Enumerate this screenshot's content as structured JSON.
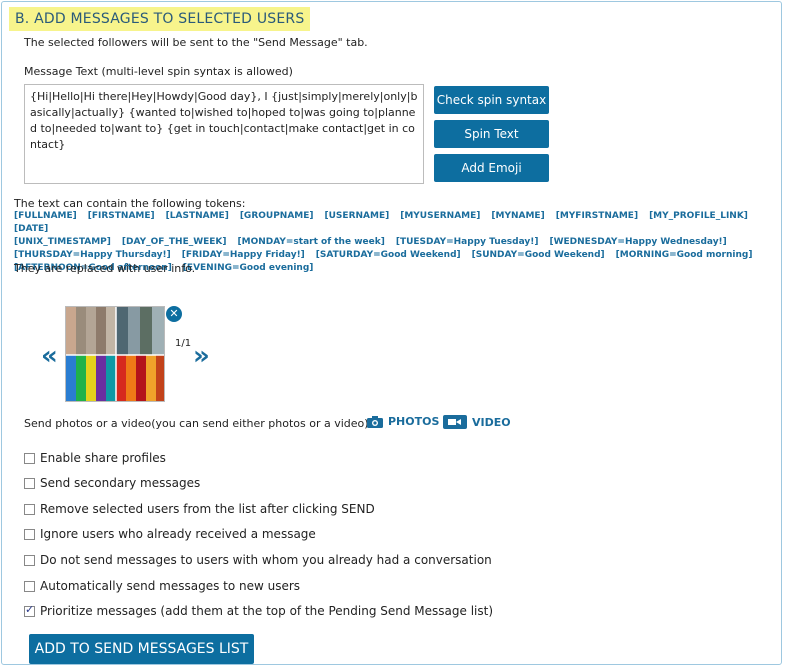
{
  "section": {
    "title": "B. ADD MESSAGES TO SELECTED USERS",
    "note": "The selected followers will be sent to the \"Send Message\" tab."
  },
  "message": {
    "label": "Message Text  (multi-level spin syntax is allowed)",
    "text": "{Hi|Hello|Hi there|Hey|Howdy|Good day}, I {just|simply|merely|only|basically|actually} {wanted to|wished to|hoped to|was going to|planned to|needed to|want to} {get in touch|contact|make contact|get in contact}"
  },
  "buttons": {
    "check_spin": "Check spin syntax",
    "spin_text": "Spin Text",
    "add_emoji": "Add Emoji",
    "add_to_list": "ADD TO SEND MESSAGES LIST"
  },
  "tokens": {
    "intro": "The text can contain the following tokens:",
    "items": [
      "[FULLNAME]",
      "[FIRSTNAME]",
      "[LASTNAME]",
      "[GROUPNAME]",
      "[USERNAME]",
      "[MYUSERNAME]",
      "[MYNAME]",
      "[MYFIRSTNAME]",
      "[MY_PROFILE_LINK]",
      "[DATE]",
      "[UNIX_TIMESTAMP]",
      "[DAY_OF_THE_WEEK]",
      "[MONDAY=start of the week]",
      "[TUESDAY=Happy Tuesday!]",
      "[WEDNESDAY=Happy Wednesday!]",
      "[THURSDAY=Happy Thursday!]",
      "[FRIDAY=Happy Friday!]",
      "[SATURDAY=Good Weekend]",
      "[SUNDAY=Good Weekend]",
      "[MORNING=Good morning]",
      "[AFTERNOON=Good afternoon]",
      "[EVENING=Good evening]"
    ],
    "outro": "They are replaced with user info."
  },
  "media": {
    "counter": "1/1",
    "label": "Send photos or a video(you can send either photos or a video)",
    "photos": "PHOTOS",
    "video": "VIDEO",
    "prev_icon": "double-chevron-left-icon",
    "next_icon": "double-chevron-right-icon",
    "remove_icon": "close-icon"
  },
  "options": [
    {
      "label": "Enable share profiles",
      "checked": false
    },
    {
      "label": "Send secondary messages",
      "checked": false
    },
    {
      "label": "Remove selected users from the list after clicking SEND",
      "checked": false
    },
    {
      "label": "Ignore users who already received a message",
      "checked": false
    },
    {
      "label": "Do not send messages to users with whom you already had a conversation",
      "checked": false
    },
    {
      "label": "Automatically send messages to new users",
      "checked": false
    },
    {
      "label": "Prioritize messages (add them at the top of the Pending Send Message list)",
      "checked": true
    }
  ],
  "colors": {
    "accent": "#0d6ea0",
    "title_highlight": "#f7f48c",
    "token_text": "#1a6c9c"
  }
}
